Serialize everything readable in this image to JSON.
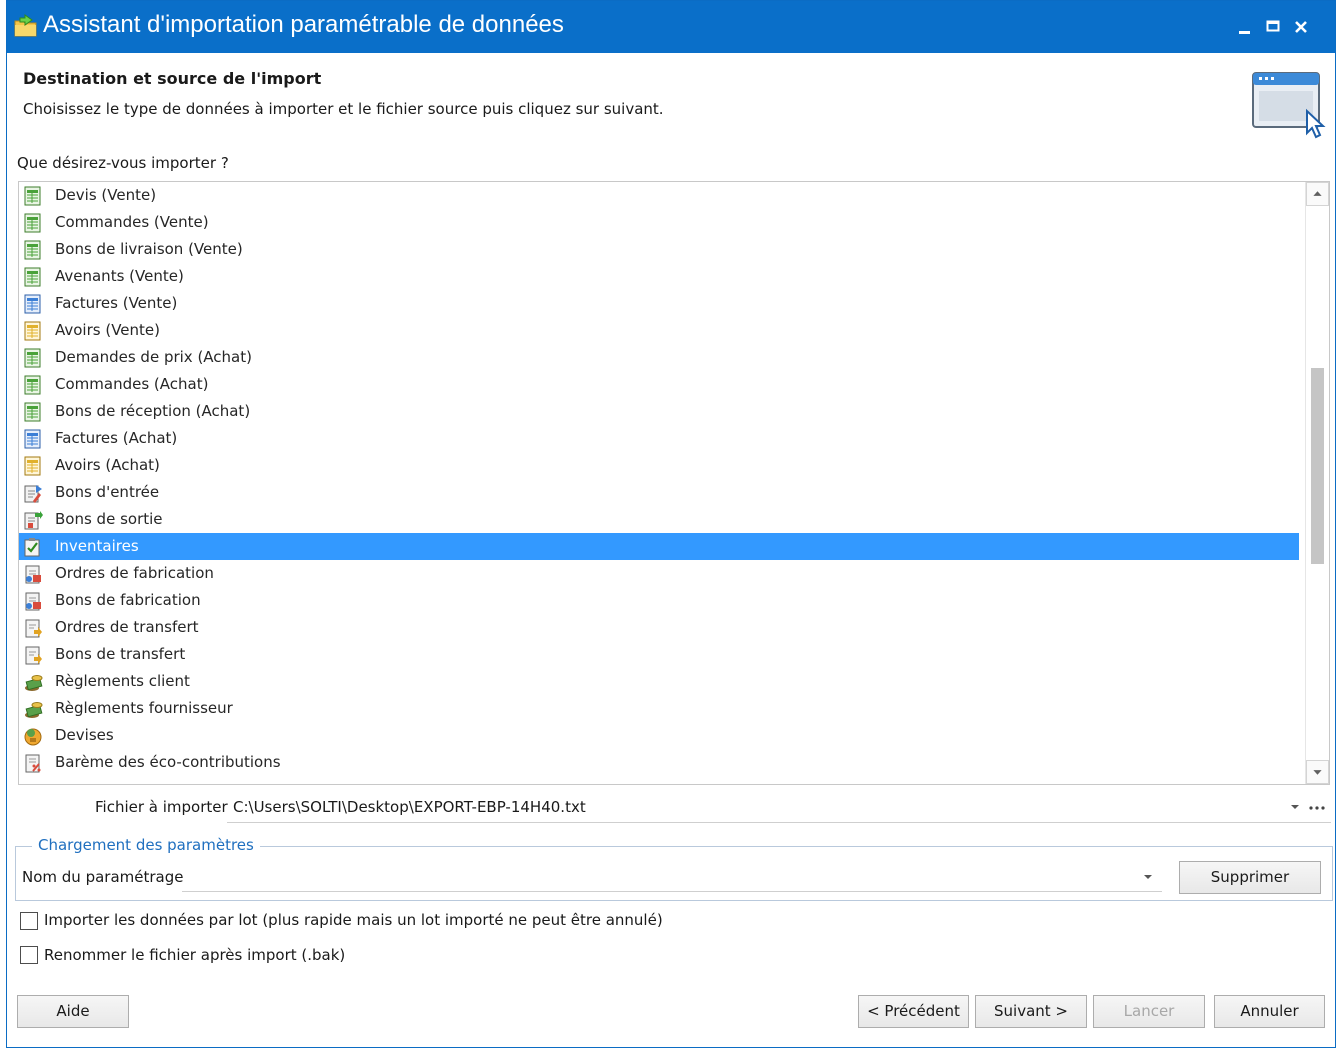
{
  "window": {
    "title": "Assistant d'importation paramétrable de données"
  },
  "header": {
    "title": "Destination et source de l'import",
    "description": "Choisissez le type de données à importer et le fichier source puis cliquez sur suivant."
  },
  "import_list": {
    "label": "Que désirez-vous importer ?",
    "items": [
      {
        "label": "Devis (Vente)",
        "icon": "green-grid-icon"
      },
      {
        "label": "Commandes (Vente)",
        "icon": "green-grid-icon"
      },
      {
        "label": "Bons de livraison (Vente)",
        "icon": "green-grid-icon"
      },
      {
        "label": "Avenants (Vente)",
        "icon": "green-grid-icon"
      },
      {
        "label": "Factures (Vente)",
        "icon": "blue-grid-icon"
      },
      {
        "label": "Avoirs (Vente)",
        "icon": "yellow-grid-icon"
      },
      {
        "label": "Demandes de prix (Achat)",
        "icon": "green-grid-icon"
      },
      {
        "label": "Commandes (Achat)",
        "icon": "green-grid-icon"
      },
      {
        "label": "Bons de réception (Achat)",
        "icon": "green-grid-icon"
      },
      {
        "label": "Factures (Achat)",
        "icon": "blue-grid-icon"
      },
      {
        "label": "Avoirs (Achat)",
        "icon": "yellow-grid-icon"
      },
      {
        "label": "Bons d'entrée",
        "icon": "stock-in-icon"
      },
      {
        "label": "Bons de sortie",
        "icon": "stock-out-icon"
      },
      {
        "label": "Inventaires",
        "icon": "inventory-check-icon"
      },
      {
        "label": "Ordres de fabrication",
        "icon": "manufacturing-icon"
      },
      {
        "label": "Bons de fabrication",
        "icon": "manufacturing-icon"
      },
      {
        "label": "Ordres de transfert",
        "icon": "transfer-icon"
      },
      {
        "label": "Bons de transfert",
        "icon": "transfer-icon"
      },
      {
        "label": "Règlements client",
        "icon": "payment-coins-icon"
      },
      {
        "label": "Règlements fournisseur",
        "icon": "payment-coins-icon"
      },
      {
        "label": "Devises",
        "icon": "currency-icon"
      },
      {
        "label": "Barème des éco-contributions",
        "icon": "eco-contribution-icon"
      }
    ],
    "selected_index": 13
  },
  "file": {
    "label": "Fichier à importer",
    "value": "C:\\Users\\SOLTI\\Desktop\\EXPORT-EBP-14H40.txt"
  },
  "params": {
    "legend": "Chargement des paramètres",
    "name_label": "Nom du paramétrage",
    "name_value": "",
    "delete_label": "Supprimer"
  },
  "options": {
    "batch_label": "Importer les données par lot (plus rapide mais un lot importé ne peut être annulé)",
    "batch_checked": false,
    "rename_label": "Renommer le fichier après import (.bak)",
    "rename_checked": false
  },
  "footer": {
    "help_label": "Aide",
    "previous_label": "< Précédent",
    "next_label": "Suivant >",
    "launch_label": "Lancer",
    "cancel_label": "Annuler"
  },
  "colors": {
    "titlebar": "#0a6fc9",
    "selection": "#3399ff",
    "group_legend": "#1f6fbf"
  }
}
